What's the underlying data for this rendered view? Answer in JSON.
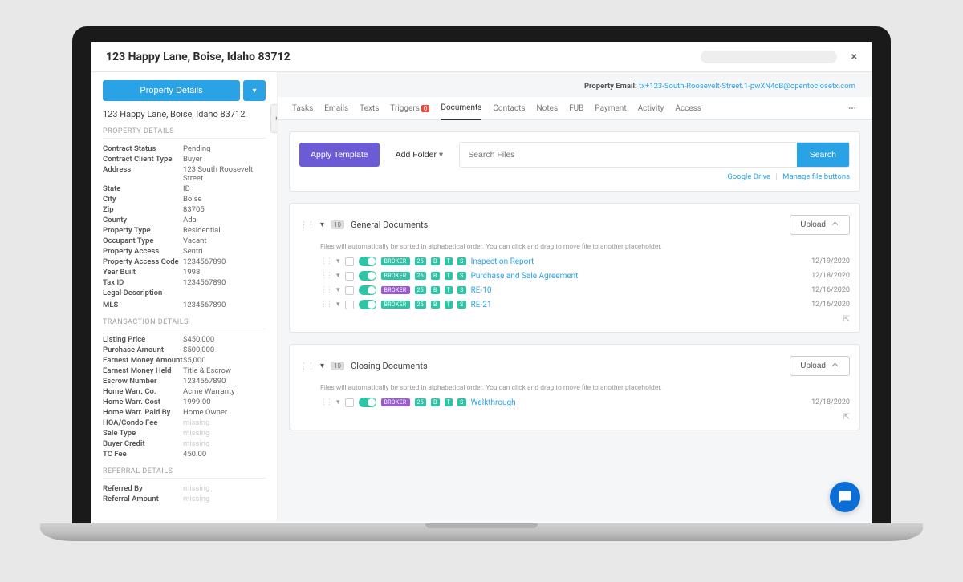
{
  "header": {
    "title": "123 Happy Lane, Boise, Idaho 83712",
    "close": "×"
  },
  "sidebar": {
    "main_button": "Property Details",
    "address_line": "123 Happy Lane, Boise, Idaho 83712",
    "sections": {
      "property": {
        "heading": "PROPERTY DETAILS",
        "rows": [
          {
            "k": "Contract Status",
            "v": "Pending"
          },
          {
            "k": "Contract Client Type",
            "v": "Buyer"
          },
          {
            "k": "Address",
            "v": "123 South Roosevelt Street"
          },
          {
            "k": "State",
            "v": "ID"
          },
          {
            "k": "City",
            "v": "Boise"
          },
          {
            "k": "Zip",
            "v": "83705"
          },
          {
            "k": "County",
            "v": "Ada"
          },
          {
            "k": "Property Type",
            "v": "Residential"
          },
          {
            "k": "Occupant Type",
            "v": "Vacant"
          },
          {
            "k": "Property Access",
            "v": "Sentri"
          },
          {
            "k": "Property Access Code",
            "v": "1234567890"
          },
          {
            "k": "Year Built",
            "v": "1998"
          },
          {
            "k": "Tax ID",
            "v": "1234567890"
          },
          {
            "k": "Legal Description",
            "v": ""
          },
          {
            "k": "",
            "v": "",
            "muted": true
          },
          {
            "k": "MLS",
            "v": "1234567890"
          }
        ]
      },
      "transaction": {
        "heading": "TRANSACTION DETAILS",
        "rows": [
          {
            "k": "Listing Price",
            "v": "$450,000"
          },
          {
            "k": "Purchase Amount",
            "v": "$500,000"
          },
          {
            "k": "Earnest Money Amount",
            "v": "$5,000"
          },
          {
            "k": "Earnest Money Held",
            "v": "Title & Escrow"
          },
          {
            "k": "Escrow Number",
            "v": "1234567890"
          },
          {
            "k": "Home Warr. Co.",
            "v": "Acme Warranty"
          },
          {
            "k": "Home Warr. Cost",
            "v": "1999.00"
          },
          {
            "k": "Home Warr. Paid By",
            "v": "Home Owner"
          },
          {
            "k": "HOA/Condo Fee",
            "v": "missing",
            "muted": true
          },
          {
            "k": "Sale Type",
            "v": "missing",
            "muted": true
          },
          {
            "k": "Buyer Credit",
            "v": "missing",
            "muted": true
          },
          {
            "k": "TC Fee",
            "v": "450.00"
          }
        ]
      },
      "referral": {
        "heading": "REFERRAL DETAILS",
        "rows": [
          {
            "k": "Referred By",
            "v": "missing",
            "muted": true
          },
          {
            "k": "Referral Amount",
            "v": "missing",
            "muted": true
          }
        ]
      }
    }
  },
  "main": {
    "prop_email_label": "Property Email:",
    "prop_email_value": "tx+123-South-Roosevelt-Street.1-pwXN4cB@opentoclosetx.com",
    "tabs": [
      "Tasks",
      "Emails",
      "Texts",
      "Triggers",
      "Documents",
      "Contacts",
      "Notes",
      "FUB",
      "Payment",
      "Activity",
      "Access"
    ],
    "tabs_active": "Documents",
    "triggers_badge": "0",
    "toolbar": {
      "apply": "Apply Template",
      "add_folder": "Add Folder",
      "search_placeholder": "Search Files",
      "search_btn": "Search",
      "link_drive": "Google Drive",
      "link_manage": "Manage file buttons"
    },
    "sort_hint": "Files will automatically be sorted in alphabetical order. You can click and drag to move file to another placeholder.",
    "upload_label": "Upload",
    "folders": [
      {
        "name": "General Documents",
        "count": "10",
        "docs": [
          {
            "tag": "BROKER",
            "tag_color": "green",
            "name": "Inspection Report",
            "date": "12/19/2020"
          },
          {
            "tag": "BROKER",
            "tag_color": "green",
            "name": "Purchase and Sale Agreement",
            "date": "12/18/2020"
          },
          {
            "tag": "BROKER",
            "tag_color": "purple",
            "name": "RE-10",
            "date": "12/16/2020"
          },
          {
            "tag": "BROKER",
            "tag_color": "green",
            "name": "RE-21",
            "date": "12/16/2020"
          }
        ]
      },
      {
        "name": "Closing Documents",
        "count": "10",
        "docs": [
          {
            "tag": "BROKER",
            "tag_color": "purple",
            "name": "Walkthrough",
            "date": "12/18/2020"
          }
        ]
      }
    ]
  }
}
